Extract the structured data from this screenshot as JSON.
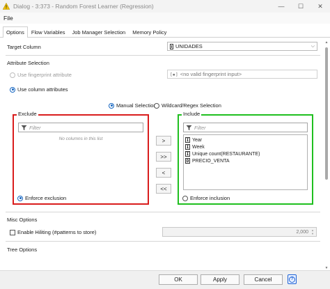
{
  "window": {
    "title": "Dialog - 3:373 - Random Forest Learner (Regression)",
    "warning_icon": "warning-icon",
    "controls": {
      "minimize": "—",
      "maximize": "☐",
      "close": "✕"
    }
  },
  "menu": {
    "file": "File"
  },
  "tabs": [
    {
      "label": "Options",
      "active": true
    },
    {
      "label": "Flow Variables",
      "active": false
    },
    {
      "label": "Job Manager Selection",
      "active": false
    },
    {
      "label": "Memory Policy",
      "active": false
    }
  ],
  "target_column": {
    "label": "Target Column",
    "value": "UNIDADES"
  },
  "attribute_selection": {
    "label": "Attribute Selection",
    "fingerprint_option": "Use fingerprint attribute",
    "fingerprint_dropdown": "<no valid fingerprint input>",
    "column_option": "Use column attributes"
  },
  "selection_mode": {
    "manual": "Manual Selection",
    "wildcard": "Wildcard/Regex Selection"
  },
  "exclude": {
    "legend": "Exclude",
    "filter_placeholder": "Filter",
    "empty_message": "No columns in this list",
    "enforce": "Enforce exclusion"
  },
  "include": {
    "legend": "Include",
    "filter_placeholder": "Filter",
    "columns": [
      {
        "type": "I",
        "name": "Year"
      },
      {
        "type": "I",
        "name": "Week"
      },
      {
        "type": "I",
        "name": "Unique count(RESTAURANTE)"
      },
      {
        "type": "D",
        "name": "PRECIO_VENTA"
      }
    ],
    "enforce": "Enforce inclusion"
  },
  "move_buttons": {
    "add": ">",
    "add_all": ">>",
    "remove": "<",
    "remove_all": "<<"
  },
  "misc": {
    "label": "Misc Options",
    "hiliting": "Enable Hiliting (#patterns to store)",
    "hiliting_value": "2,000"
  },
  "tree_options": {
    "label": "Tree Options"
  },
  "footer": {
    "ok": "OK",
    "apply": "Apply",
    "cancel": "Cancel",
    "help": "?"
  },
  "colors": {
    "exclude_border": "#d91c1c",
    "include_border": "#1fbf1f",
    "accent": "#1565c0"
  }
}
